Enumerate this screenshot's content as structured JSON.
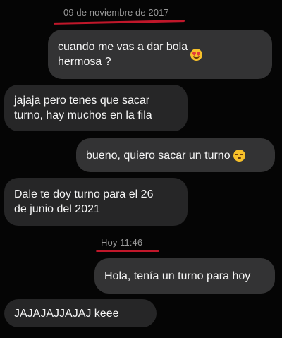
{
  "messages": {
    "date_1": "09 de noviembre de 2017",
    "m1": "cuando me vas a dar bola\nhermosa ?",
    "m1_emoji": "heart-eyes-emoji",
    "m2": "jajaja pero tenes que sacar\nturno, hay muchos en la fila",
    "m3": "bueno, quiero sacar un turno",
    "m3_emoji": "pensive-emoji",
    "m4": "Dale te doy turno para el 26\nde junio del 2021",
    "date_2": "Hoy 11:46",
    "m5": "Hola, tenía un turno para hoy",
    "m6": "JAJAJAJJAJAJ keee"
  },
  "colors": {
    "background": "#050505",
    "bubble_outgoing": "#333334",
    "bubble_incoming": "#262627",
    "underline_annotation": "#c0172a",
    "date_text": "#9a9a9a"
  }
}
